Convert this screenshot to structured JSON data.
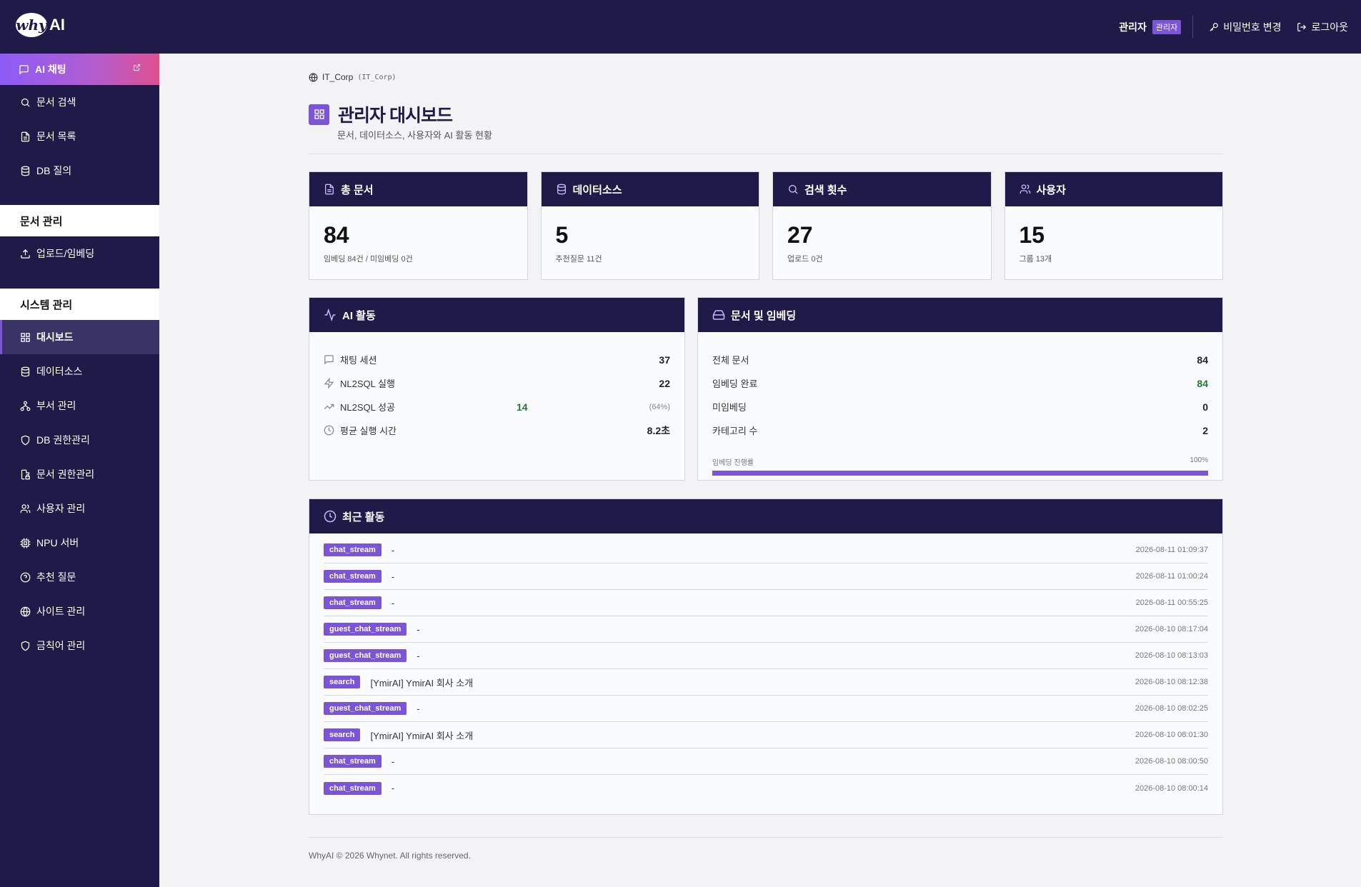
{
  "header": {
    "logo_mark": "why",
    "logo_text": "AI",
    "admin_name": "관리자",
    "admin_badge": "관리자",
    "change_password": "비밀번호 변경",
    "logout": "로그아웃"
  },
  "sidebar": {
    "chat": "AI 채팅",
    "doc_search": "문서 검색",
    "doc_list": "문서 목록",
    "db_query": "DB 질의",
    "section_docs": "문서 관리",
    "upload": "업로드/임베딩",
    "section_system": "시스템 관리",
    "dashboard": "대시보드",
    "datasource": "데이터소스",
    "dept": "부서 관리",
    "db_perm": "DB 권한관리",
    "doc_perm": "문서 권한관리",
    "users": "사용자 관리",
    "npu": "NPU 서버",
    "recommend": "추천 질문",
    "site": "사이트 관리",
    "banned": "금칙어 관리"
  },
  "breadcrumb": {
    "name": "IT_Corp",
    "code": "(IT_Corp)"
  },
  "page": {
    "title": "관리자 대시보드",
    "subtitle": "문서, 데이터소스, 사용자와 AI 활동 현황"
  },
  "stats": {
    "docs": {
      "label": "총 문서",
      "value": "84",
      "sub": "임베딩 84건 / 미임베딩 0건"
    },
    "datasource": {
      "label": "데이터소스",
      "value": "5",
      "sub": "추천질문 11건"
    },
    "search": {
      "label": "검색 횟수",
      "value": "27",
      "sub": "업로드 0건"
    },
    "users": {
      "label": "사용자",
      "value": "15",
      "sub": "그룹 13개"
    }
  },
  "ai_activity": {
    "title": "AI 활동",
    "chat_sessions": {
      "label": "채팅 세션",
      "value": "37"
    },
    "nl2sql_runs": {
      "label": "NL2SQL 실행",
      "value": "22"
    },
    "nl2sql_success": {
      "label": "NL2SQL 성공",
      "value": "14",
      "pct": "(64%)"
    },
    "avg_time": {
      "label": "평균 실행 시간",
      "value": "8.2초"
    }
  },
  "doc_embedding": {
    "title": "문서 및 임베딩",
    "total": {
      "label": "전체 문서",
      "value": "84"
    },
    "embedded": {
      "label": "임베딩 완료",
      "value": "84"
    },
    "not_embedded": {
      "label": "미임베딩",
      "value": "0"
    },
    "categories": {
      "label": "카테고리 수",
      "value": "2"
    },
    "progress_label": "임베딩 진행률",
    "progress_pct": "100%",
    "progress_value": 1.0
  },
  "recent": {
    "title": "최근 활동",
    "rows": [
      {
        "tag": "chat_stream",
        "text": "-",
        "time": "2026-08-11 01:09:37"
      },
      {
        "tag": "chat_stream",
        "text": "-",
        "time": "2026-08-11 01:00:24"
      },
      {
        "tag": "chat_stream",
        "text": "-",
        "time": "2026-08-11 00:55:25"
      },
      {
        "tag": "guest_chat_stream",
        "text": "-",
        "time": "2026-08-10 08:17:04"
      },
      {
        "tag": "guest_chat_stream",
        "text": "-",
        "time": "2026-08-10 08:13:03"
      },
      {
        "tag": "search",
        "text": "[YmirAI] YmirAI 회사 소개",
        "time": "2026-08-10 08:12:38"
      },
      {
        "tag": "guest_chat_stream",
        "text": "-",
        "time": "2026-08-10 08:02:25"
      },
      {
        "tag": "search",
        "text": "[YmirAI] YmirAI 회사 소개",
        "time": "2026-08-10 08:01:30"
      },
      {
        "tag": "chat_stream",
        "text": "-",
        "time": "2026-08-10 08:00:50"
      },
      {
        "tag": "chat_stream",
        "text": "-",
        "time": "2026-08-10 08:00:14"
      }
    ]
  },
  "footer": {
    "text": "WhyAI © 2026 Whynet. All rights reserved."
  },
  "colors": {
    "navy": "#1f1a48",
    "accent": "#7b55d6",
    "success": "#1d7a35"
  }
}
